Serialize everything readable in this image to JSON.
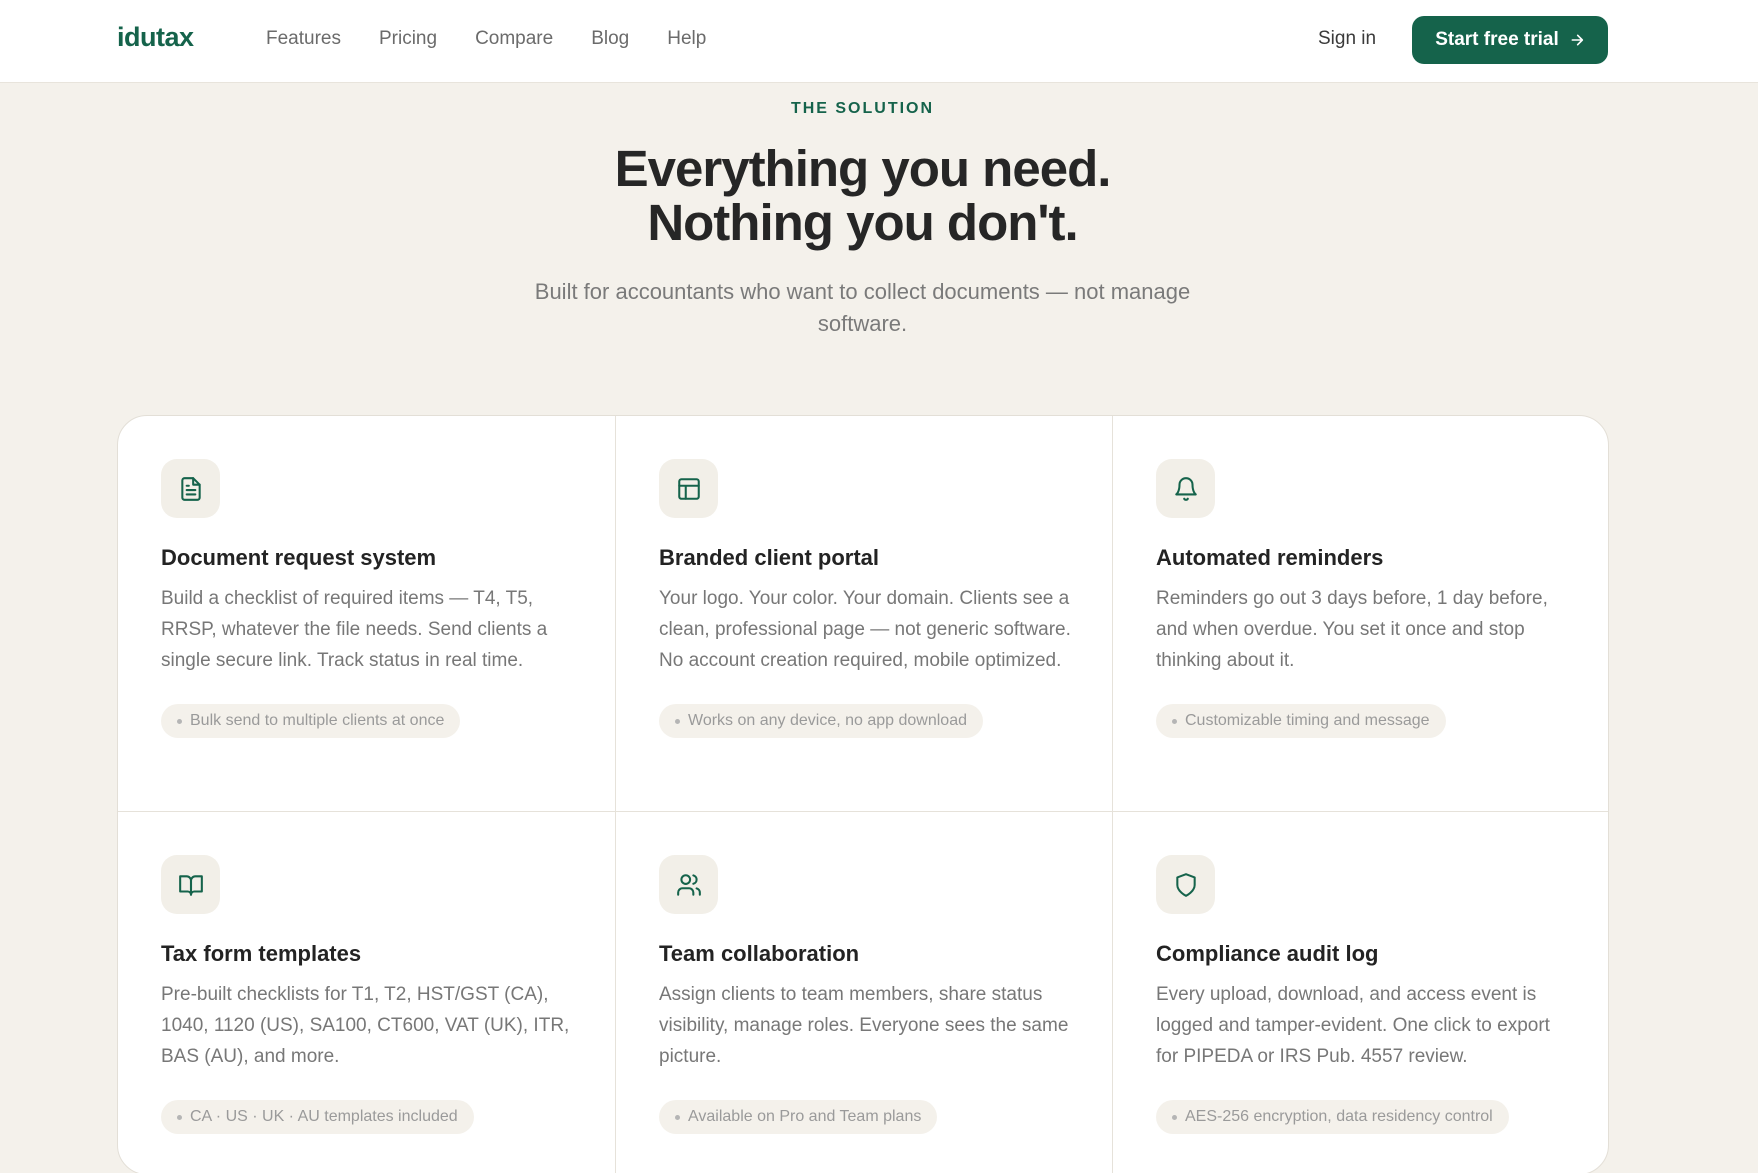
{
  "nav": {
    "logo": "idutax",
    "links": [
      "Features",
      "Pricing",
      "Compare",
      "Blog",
      "Help"
    ],
    "signin": "Sign in",
    "cta": "Start free trial",
    "cta_icon": "arrow-right-icon"
  },
  "hero": {
    "eyebrow": "THE SOLUTION",
    "headline_line1": "Everything you need.",
    "headline_line2": "Nothing you don't.",
    "sub_line1": "Built for accountants who want to collect documents — not manage",
    "sub_line2": "software."
  },
  "features": [
    {
      "icon": "file-text-icon",
      "title": "Document request system",
      "desc": "Build a checklist of required items — T4, T5, RRSP, whatever the file needs. Send clients a single secure link. Track status in real time.",
      "tag": "Bulk send to multiple clients at once"
    },
    {
      "icon": "layout-icon",
      "title": "Branded client portal",
      "desc": "Your logo. Your color. Your domain. Clients see a clean, professional page — not generic software. No account creation required, mobile optimized.",
      "tag": "Works on any device, no app download"
    },
    {
      "icon": "bell-icon",
      "title": "Automated reminders",
      "desc": "Reminders go out 3 days before, 1 day before, and when overdue. You set it once and stop thinking about it.",
      "tag": "Customizable timing and message"
    },
    {
      "icon": "book-open-icon",
      "title": "Tax form templates",
      "desc": "Pre-built checklists for T1, T2, HST/GST (CA), 1040, 1120 (US), SA100, CT600, VAT (UK), ITR, BAS (AU), and more.",
      "tag": "CA · US · UK · AU templates included"
    },
    {
      "icon": "users-icon",
      "title": "Team collaboration",
      "desc": "Assign clients to team members, share status visibility, manage roles. Everyone sees the same picture.",
      "tag": "Available on Pro and Team plans"
    },
    {
      "icon": "shield-icon",
      "title": "Compliance audit log",
      "desc": "Every upload, download, and access event is logged and tamper-evident. One click to export for PIPEDA or IRS Pub. 4557 review.",
      "tag": "AES-256 encryption, data residency control"
    }
  ],
  "colors": {
    "brand": "#15634b",
    "background": "#f4f1eb",
    "card": "#ffffff"
  }
}
